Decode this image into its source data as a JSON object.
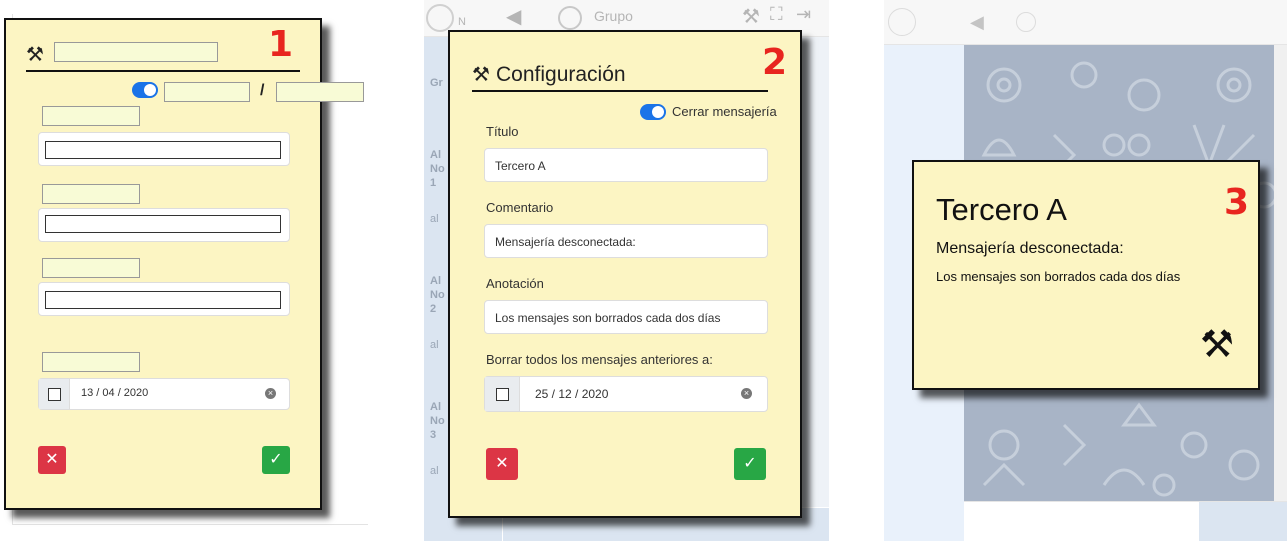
{
  "panels": {
    "p1": {
      "number": "1",
      "separator": "/",
      "date_value": "13 / 04 / 2020",
      "cancel_label": "✕",
      "confirm_label": "✓"
    },
    "p2": {
      "number": "2",
      "header_group": "Grupo",
      "header_sub": "N",
      "dialog_title": "Configuración",
      "toggle_label": "Cerrar mensajería",
      "titulo_label": "Título",
      "titulo_value": "Tercero A",
      "comentario_label": "Comentario",
      "comentario_value": "Mensajería desconectada:",
      "anotacion_label": "Anotación",
      "anotacion_value": "Los mensajes son borrados cada dos días",
      "borrar_label": "Borrar todos los mensajes anteriores a:",
      "date_value": "25 / 12 / 2020",
      "cancel_label": "✕",
      "confirm_label": "✓",
      "sidebar_fragments": [
        "Gr",
        "Al",
        "No",
        "1",
        "al",
        "Al",
        "No",
        "2",
        "al",
        "Al",
        "No",
        "3",
        "al"
      ]
    },
    "p3": {
      "number": "3",
      "title": "Tercero A",
      "comment": "Mensajería desconectada:",
      "annotation": "Los mensajes son borrados cada dos días"
    }
  },
  "colors": {
    "note_bg": "#fcf5c3",
    "number_red": "#e8251f",
    "toggle_blue": "#1a73e8",
    "cancel_red": "#dc3545",
    "confirm_green": "#28a745",
    "chat_bg": "#a8b4c6"
  },
  "icons": [
    "tools-icon",
    "back-arrow-icon",
    "group-avatar-icon",
    "fullscreen-icon",
    "exit-icon"
  ]
}
